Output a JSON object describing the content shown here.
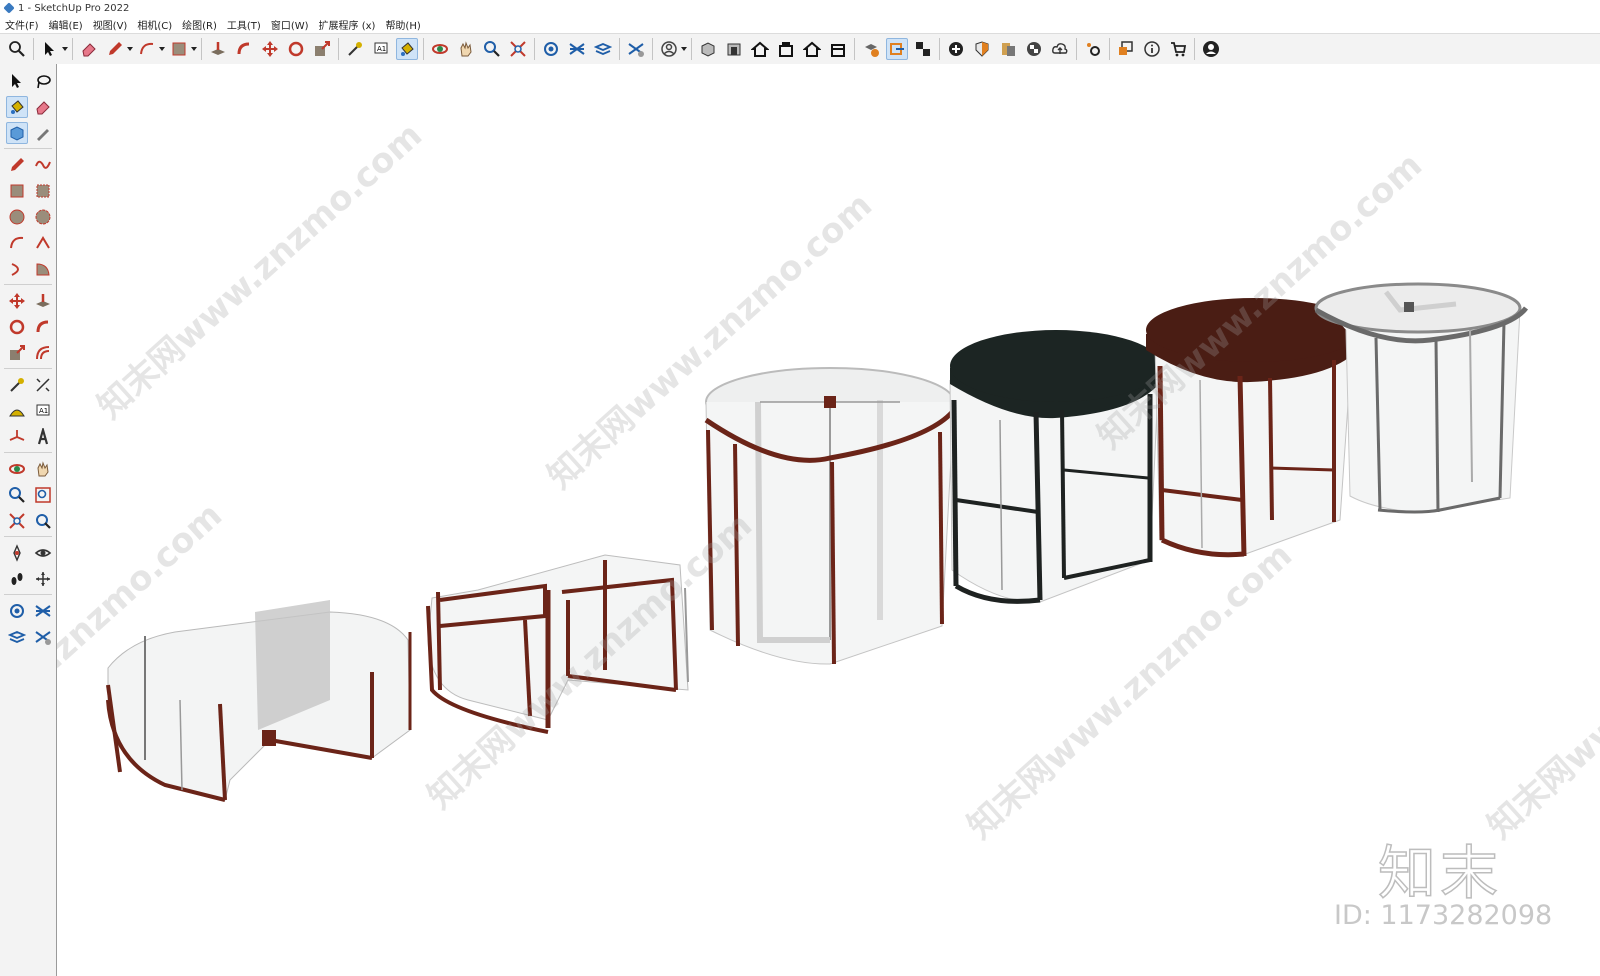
{
  "window": {
    "title": "1 - SketchUp Pro 2022"
  },
  "menu": [
    "文件(F)",
    "编辑(E)",
    "视图(V)",
    "相机(C)",
    "绘图(R)",
    "工具(T)",
    "窗口(W)",
    "扩展程序 (x)",
    "帮助(H)"
  ],
  "colors": {
    "frame_brown": "#6b2418",
    "frame_black": "#1e2221",
    "canopy_black": "#1c2523",
    "canopy_brown": "#4a1d14",
    "glass": "#e8eaea",
    "frame_gray": "#6a6a6a"
  },
  "toolbar_icons": [
    "zoom-extents-icon",
    "select-icon",
    "eraser-icon",
    "pencil-icon",
    "arc-icon",
    "rectangle-icon",
    "push-pull-icon",
    "follow-me-icon",
    "move-icon",
    "rotate-icon",
    "scale-icon",
    "tape-measure-icon",
    "text-icon",
    "paint-bucket-icon",
    "orbit-icon",
    "pan-icon",
    "zoom-icon",
    "zoom-window-icon",
    "warehouse-icon",
    "sandbox-icon",
    "tags-icon",
    "styles-icon",
    "account-icon",
    "iso-view-icon",
    "top-view-icon",
    "front-view-icon",
    "right-view-icon",
    "back-view-icon",
    "left-view-icon",
    "model-info-icon",
    "section-plane-icon",
    "section-display-icon",
    "add-location-icon",
    "shadow-icon",
    "layout-icon",
    "checker-icon",
    "upload-icon",
    "extension-icon",
    "component-icon",
    "info-icon",
    "cart-icon",
    "user-icon"
  ],
  "watermark": {
    "site": "知末网www.znzmo.com",
    "brand": "知末",
    "id": "ID: 1173282098"
  }
}
